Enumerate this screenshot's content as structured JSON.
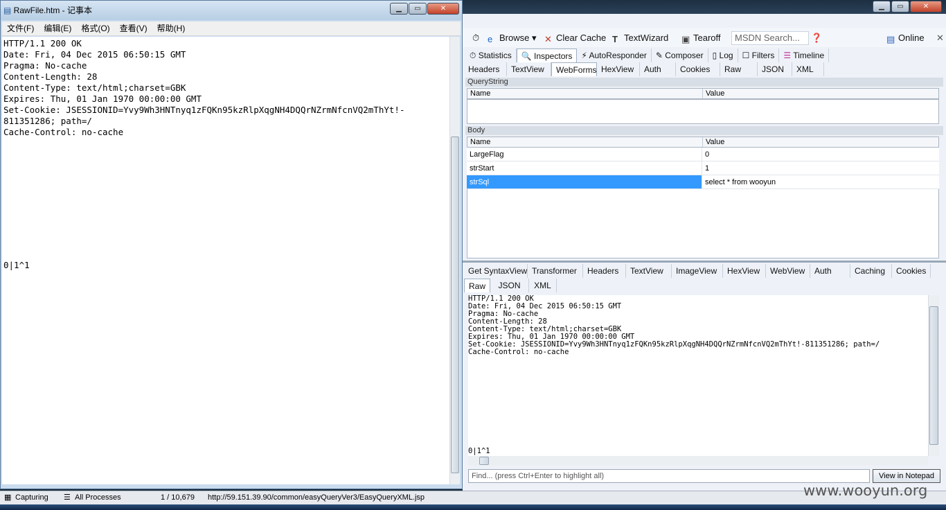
{
  "notepad": {
    "title": "RawFile.htm - 记事本",
    "menu": [
      "文件(F)",
      "编辑(E)",
      "格式(O)",
      "查看(V)",
      "帮助(H)"
    ],
    "content": "HTTP/1.1 200 OK\nDate: Fri, 04 Dec 2015 06:50:15 GMT\nPragma: No-cache\nContent-Length: 28\nContent-Type: text/html;charset=GBK\nExpires: Thu, 01 Jan 1970 00:00:00 GMT\nSet-Cookie: JSESSIONID=Yvy9Wh3HNTnyq1zFQKn95kzRlpXqgNH4DQQrNZrmNfcnVQ2mThYt!-\n811351286; path=/\nCache-Control: no-cache\n\n\n\n\n\n\n\n\n\n\n\n0|1^1"
  },
  "fiddler": {
    "toolbar": {
      "browse": "Browse",
      "clear_cache": "Clear Cache",
      "textwizard": "TextWizard",
      "tearoff": "Tearoff",
      "msdn_search": "MSDN Search...",
      "online": "Online"
    },
    "main_tabs": [
      "Statistics",
      "Inspectors",
      "AutoResponder",
      "Composer",
      "Log",
      "Filters",
      "Timeline"
    ],
    "request_tabs": [
      "Headers",
      "TextView",
      "WebForms",
      "HexView",
      "Auth",
      "Cookies",
      "Raw",
      "JSON",
      "XML"
    ],
    "querystring": {
      "label": "QueryString",
      "col_name": "Name",
      "col_value": "Value"
    },
    "body": {
      "label": "Body",
      "col_name": "Name",
      "col_value": "Value",
      "rows": [
        {
          "name": "LargeFlag",
          "value": "0"
        },
        {
          "name": "strStart",
          "value": "1"
        },
        {
          "name": "strSql",
          "value": "select * from wooyun"
        }
      ]
    },
    "response_tabs": [
      "Get SyntaxView",
      "Transformer",
      "Headers",
      "TextView",
      "ImageView",
      "HexView",
      "WebView",
      "Auth",
      "Caching",
      "Cookies"
    ],
    "response_tabs2": [
      "Raw",
      "JSON",
      "XML"
    ],
    "raw_response": "HTTP/1.1 200 OK\nDate: Fri, 04 Dec 2015 06:50:15 GMT\nPragma: No-cache\nContent-Length: 28\nContent-Type: text/html;charset=GBK\nExpires: Thu, 01 Jan 1970 00:00:00 GMT\nSet-Cookie: JSESSIONID=Yvy9Wh3HNTnyq1zFQKn95kzRlpXqgNH4DQQrNZrmNfcnVQ2mThYt!-811351286; path=/\nCache-Control: no-cache\n\n\n\n\n\n\n\n\n\n\n\n\n0|1^1",
    "find_placeholder": "Find... (press Ctrl+Enter to highlight all)",
    "view_in_notepad": "View in Notepad"
  },
  "statusbar": {
    "capturing": "Capturing",
    "processes": "All Processes",
    "count": "1 / 10,679",
    "url": "http://59.151.39.90/common/easyQueryVer3/EasyQueryXML.jsp"
  },
  "watermark": "www.wooyun.org",
  "colors": {
    "selection": "#3399ff",
    "accent": "#1f4e8c"
  }
}
